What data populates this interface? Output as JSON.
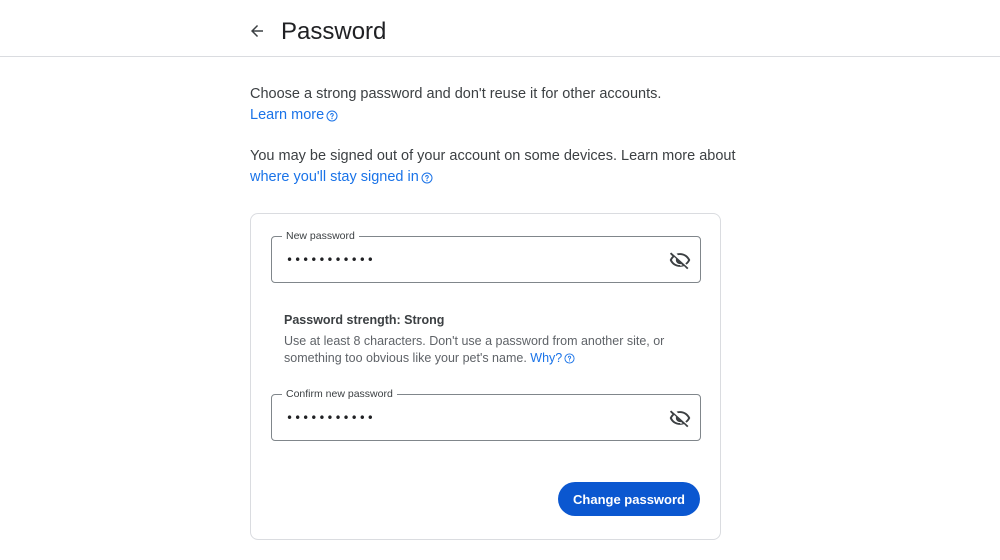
{
  "header": {
    "title": "Password"
  },
  "intro": {
    "text1": "Choose a strong password and don't reuse it for other accounts.",
    "learn_more": "Learn more",
    "text2": "You may be signed out of your account on some devices. Learn more about",
    "stay_signed_in_link": "where you'll stay signed in"
  },
  "form": {
    "new_password": {
      "label": "New password",
      "value": "•••••••••••"
    },
    "strength": {
      "title": "Password strength: Strong",
      "hint": "Use at least 8 characters. Don't use a password from another site, or something too obvious like your pet's name.",
      "why_link": "Why?"
    },
    "confirm_password": {
      "label": "Confirm new password",
      "value": "•••••••••••"
    },
    "submit_label": "Change password"
  },
  "icons": {
    "back": "arrow-back-icon",
    "help": "help-circle-icon",
    "visibility": "visibility-off-icon"
  },
  "colors": {
    "link": "#1a73e8",
    "primary_button": "#0b57d0"
  }
}
